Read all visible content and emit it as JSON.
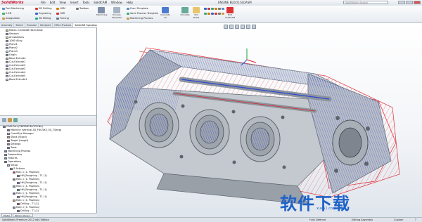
{
  "app": {
    "logo": "SolidWorks",
    "doc_title": "ENGINE BLOCK.SLDASM",
    "search_placeholder": "SolidWorks Search"
  },
  "menus": [
    "File",
    "Edit",
    "View",
    "Insert",
    "Tools",
    "SolidCAM",
    "Window",
    "Help"
  ],
  "ribbon": {
    "col1": [
      "Part Machining",
      "2.5D",
      "Assignation"
    ],
    "col2": [
      "3D Drilling",
      "Engraving",
      "3D Milling"
    ],
    "col3": [
      "HSM",
      "HSR",
      "Turning"
    ],
    "col4": [
      "Toolbox"
    ],
    "big1": "Machining",
    "big2": "Process Template",
    "col5": [
      "From Template",
      "Save Process Template",
      "Machining Process"
    ],
    "big3": "Calculate All",
    "big4": "Simulate",
    "big5": "Tool Sheet",
    "big6": "Exit SolidCAM"
  },
  "tabs": [
    "Assembly",
    "Sketch",
    "Evaluate",
    "DimXpert",
    "Office Products",
    "SolidCAM Operations"
  ],
  "feature_tree": [
    "Mates in ENGINE BLOCK-Ne",
    "Sensors",
    "Annotations",
    "1060 Alloy",
    "Plane1",
    "Plane2",
    "Plane3",
    "Origin",
    "Base-Extrude",
    "Cut-Extrude1",
    "Cut-Extrude2",
    "Cut-Extrude3",
    "Cut-Extrude4",
    "Cut-Extrude5",
    "Boss-Extrude1"
  ],
  "cam_tree": [
    "CAM-Part (ENGINE BLOCK-Ne)",
    "Machine (Vertical-5X_FNC5X0_5X_7Sang)",
    "CoordSys Manager",
    "Stock (Stock)",
    "Target (target)",
    "Settings",
    "Tools",
    "Machining Process",
    "Geometries",
    "Fixtures",
    "Operations",
    "Setup",
    "Z-Actives",
    "MAC 1 (1- Position)",
    "HM_Roughing - T1 (1)",
    "MAC 1 (1- Position)",
    "HM_Roughing - T1 (1)",
    "MAC 1 (1- Position)",
    "HM_Roughing - T1 (1)",
    "MAC 1 (1- Position)",
    "HM_Roughing - T1 (1)",
    "MAC 1 (1- Position)",
    "Drilling - T1 (1)",
    "MAC 1 (1- Position)",
    "Drilling - T1 (1)"
  ],
  "sheet_tabs": [
    "Model",
    "Motion Study 1"
  ],
  "status": {
    "left": "SolidWorks Premium 2012 x64 Edition",
    "right1": "Fully Defined",
    "right2": "Editing Assembly",
    "right3": "Custom",
    "right4": "?"
  },
  "watermark": {
    "text": "软件下载",
    "url": "xue51.com"
  },
  "colors": {
    "toolpath_blue": "#1f3fd0",
    "toolpath_red": "#e0202a",
    "part": "#c2c7cd",
    "accent": "#c8102e"
  }
}
